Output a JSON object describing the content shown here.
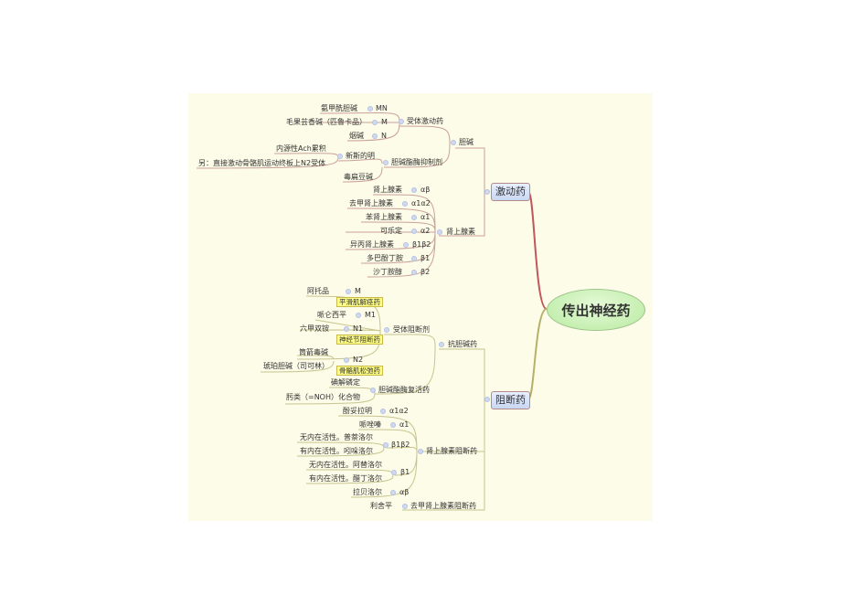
{
  "root": "传出神经药",
  "branches": {
    "agonist": {
      "label": "激动药",
      "cholinergic": {
        "label": "胆碱",
        "receptor_agonists": {
          "label": "受体激动药",
          "items": [
            {
              "drug": "氨甲酰胆碱",
              "target": "MN"
            },
            {
              "drug": "毛果芸香碱（匹鲁卡品）",
              "target": "M"
            },
            {
              "drug": "烟碱",
              "target": "N"
            }
          ]
        },
        "ache_inhibitors": {
          "label": "胆碱酯酶抑制剂",
          "neostigmine": {
            "label": "新斯的明",
            "notes": [
              "内源性Ach累积",
              "另：直接激动骨骼肌运动终板上N2受体"
            ]
          },
          "other": "毒扁豆碱"
        }
      },
      "adrenergic": {
        "label": "肾上腺素",
        "items": [
          {
            "drug": "肾上腺素",
            "target": "αβ"
          },
          {
            "drug": "去甲肾上腺素",
            "target": "α1α2"
          },
          {
            "drug": "苯肾上腺素",
            "target": "α1"
          },
          {
            "drug": "可乐定",
            "target": "α2"
          },
          {
            "drug": "异丙肾上腺素",
            "target": "β1β2"
          },
          {
            "drug": "多巴酚丁胺",
            "target": "β1"
          },
          {
            "drug": "沙丁胺醇",
            "target": "β2"
          }
        ]
      }
    },
    "blocker": {
      "label": "阻断药",
      "anticholinergic": {
        "label": "抗胆碱药",
        "receptor_blockers": {
          "label": "受体阻断剂",
          "groups": [
            {
              "target": "M",
              "category": "平滑肌解痉药",
              "drugs": [
                "阿托品"
              ]
            },
            {
              "target": "M1",
              "drugs": [
                "哌仑西平"
              ]
            },
            {
              "target": "N1",
              "category": "神经节阻断药",
              "drugs": [
                "六甲双铵"
              ]
            },
            {
              "target": "N2",
              "category": "骨骼肌松弛药",
              "drugs": [
                "筒箭毒碱",
                "琥珀胆碱（司可林）"
              ]
            }
          ]
        },
        "ache_reactivators": {
          "label": "胆碱酯酶复活药",
          "items": [
            "碘解磷定",
            "肟类（=NOH）化合物"
          ]
        }
      },
      "adrenergic_blockers": {
        "label": "肾上腺素阻断药",
        "items": [
          {
            "target": "α1α2",
            "drugs": [
              "酚妥拉明"
            ]
          },
          {
            "target": "α1",
            "drugs": [
              "哌唑嗪"
            ]
          },
          {
            "target": "β1β2",
            "drugs": [
              "无内在活性。普萘洛尔",
              "有内在活性。吲哚洛尔"
            ]
          },
          {
            "target": "β1",
            "drugs": [
              "无内在活性。阿替洛尔",
              "有内在活性。醋丁洛尔"
            ]
          },
          {
            "target": "αβ",
            "drugs": [
              "拉贝洛尔"
            ]
          }
        ]
      },
      "ne_blocker": {
        "label": "去甲肾上腺素阻断药",
        "drug": "利舍平"
      }
    }
  },
  "colors": {
    "panel_bg": "#fdfce8",
    "agonist_line": "#c0575a",
    "blocker_line": "#b5b06a",
    "root_fill": "#b7eaa0",
    "highlight": "#fffe86"
  }
}
